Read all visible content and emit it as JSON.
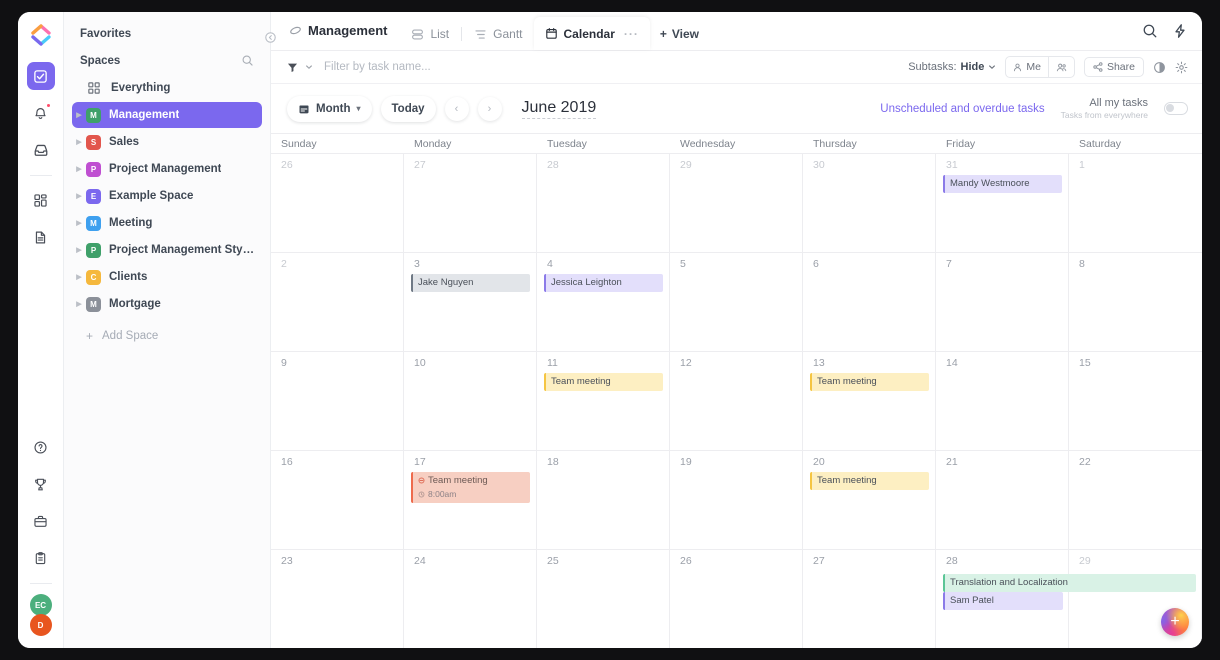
{
  "rail": {
    "logo": "clickup-logo",
    "items": [
      {
        "name": "tasks-checkbox",
        "icon": "check-square-icon",
        "active": true
      },
      {
        "name": "notifications",
        "icon": "bell-icon",
        "active": false,
        "dot": true
      },
      {
        "name": "inbox",
        "icon": "inbox-icon",
        "active": false
      },
      {
        "name": "dashboards",
        "icon": "grid-icon",
        "active": false
      },
      {
        "name": "docs",
        "icon": "document-icon",
        "active": false
      }
    ],
    "bottom_items": [
      {
        "name": "help",
        "icon": "question-circle-icon"
      },
      {
        "name": "goals",
        "icon": "trophy-icon"
      },
      {
        "name": "toolbox",
        "icon": "briefcase-icon"
      },
      {
        "name": "clipboard",
        "icon": "clipboard-icon"
      }
    ],
    "avatars": [
      {
        "initials": "EC",
        "color": "#4caf7d"
      },
      {
        "initials": "D",
        "color": "#e8551f"
      }
    ]
  },
  "sidebar": {
    "favorites_title": "Favorites",
    "spaces_title": "Spaces",
    "search_icon": "search-icon",
    "everything": {
      "label": "Everything",
      "icon": "grid-icon"
    },
    "spaces": [
      {
        "initial": "M",
        "label": "Management",
        "color": "#3fa06a",
        "selected": true
      },
      {
        "initial": "S",
        "label": "Sales",
        "color": "#e2564d",
        "selected": false
      },
      {
        "initial": "P",
        "label": "Project Management",
        "color": "#bf4fd1",
        "selected": false
      },
      {
        "initial": "E",
        "label": "Example Space",
        "color": "#7b68ee",
        "selected": false
      },
      {
        "initial": "M",
        "label": "Meeting",
        "color": "#3ea0ef",
        "selected": false
      },
      {
        "initial": "P",
        "label": "Project Management Styles",
        "color": "#3fa06a",
        "selected": false
      },
      {
        "initial": "C",
        "label": "Clients",
        "color": "#f5b83d",
        "selected": false
      },
      {
        "initial": "M",
        "label": "Mortgage",
        "color": "#8b9099",
        "selected": false
      }
    ],
    "add_space": "Add Space"
  },
  "topbar": {
    "breadcrumb": "Management",
    "breadcrumb_icon": "space-icon",
    "tabs": [
      {
        "label": "List",
        "icon": "list-icon",
        "active": false
      },
      {
        "label": "Gantt",
        "icon": "gantt-icon",
        "active": false
      },
      {
        "label": "Calendar",
        "icon": "calendar-icon",
        "active": true
      }
    ],
    "tab_overflow": "···",
    "add_view": "View",
    "add_view_plus": "+",
    "search_icon": "search-icon",
    "bolt_icon": "lightning-bolt-icon"
  },
  "filterbar": {
    "filter_icon": "filter-icon",
    "filter_caret": "chevron-down-icon",
    "placeholder": "Filter by task name...",
    "subtasks_label": "Subtasks:",
    "subtasks_value": "Hide",
    "me_label": "Me",
    "me_icon": "person-icon",
    "people_icon": "people-icon",
    "share_label": "Share",
    "share_icon": "share-icon",
    "palette_icon": "palette-icon",
    "settings_icon": "gear-icon"
  },
  "calbar": {
    "view_mode": "Month",
    "view_mode_icon": "calendar-icon",
    "view_mode_caret": "▾",
    "today": "Today",
    "prev": "‹",
    "next": "›",
    "month_title": "June 2019",
    "unscheduled_link": "Unscheduled and overdue tasks",
    "all_my_tasks": "All my tasks",
    "all_my_tasks_sub": "Tasks from everywhere",
    "toggle_on": false
  },
  "calendar": {
    "daynames": [
      "Sunday",
      "Monday",
      "Tuesday",
      "Wednesday",
      "Thursday",
      "Friday",
      "Saturday"
    ],
    "weeks": [
      {
        "days": [
          {
            "num": "26",
            "out": true,
            "events": []
          },
          {
            "num": "27",
            "out": true,
            "events": []
          },
          {
            "num": "28",
            "out": true,
            "events": []
          },
          {
            "num": "29",
            "out": true,
            "events": []
          },
          {
            "num": "30",
            "out": true,
            "events": []
          },
          {
            "num": "31",
            "out": true,
            "events": [
              {
                "title": "Mandy Westmoore",
                "style": "ev-purple"
              }
            ]
          },
          {
            "num": "1",
            "out": true,
            "events": []
          }
        ]
      },
      {
        "days": [
          {
            "num": "2",
            "out": true,
            "events": []
          },
          {
            "num": "3",
            "out": false,
            "events": [
              {
                "title": "Jake Nguyen",
                "style": "ev-gray"
              }
            ]
          },
          {
            "num": "4",
            "out": false,
            "events": [
              {
                "title": "Jessica Leighton",
                "style": "ev-purple"
              }
            ]
          },
          {
            "num": "5",
            "out": false,
            "events": []
          },
          {
            "num": "6",
            "out": false,
            "events": []
          },
          {
            "num": "7",
            "out": false,
            "events": []
          },
          {
            "num": "8",
            "out": false,
            "events": []
          }
        ]
      },
      {
        "days": [
          {
            "num": "9",
            "out": false,
            "events": []
          },
          {
            "num": "10",
            "out": false,
            "events": []
          },
          {
            "num": "11",
            "out": false,
            "events": [
              {
                "title": "Team meeting",
                "style": "ev-yellow"
              }
            ]
          },
          {
            "num": "12",
            "out": false,
            "events": []
          },
          {
            "num": "13",
            "out": false,
            "events": [
              {
                "title": "Team meeting",
                "style": "ev-yellow"
              }
            ]
          },
          {
            "num": "14",
            "out": false,
            "events": []
          },
          {
            "num": "15",
            "out": false,
            "events": []
          }
        ]
      },
      {
        "days": [
          {
            "num": "16",
            "out": false,
            "events": []
          },
          {
            "num": "17",
            "out": false,
            "events": [
              {
                "title": "Team meeting",
                "style": "ev-salmon",
                "icon": "priority-circle-icon",
                "time": "8:00am",
                "time_icon": "clock-icon"
              }
            ]
          },
          {
            "num": "18",
            "out": false,
            "events": []
          },
          {
            "num": "19",
            "out": false,
            "events": []
          },
          {
            "num": "20",
            "out": false,
            "events": [
              {
                "title": "Team meeting",
                "style": "ev-yellow"
              }
            ]
          },
          {
            "num": "21",
            "out": false,
            "events": []
          },
          {
            "num": "22",
            "out": false,
            "events": []
          }
        ]
      },
      {
        "days": [
          {
            "num": "23",
            "out": false,
            "events": []
          },
          {
            "num": "24",
            "out": false,
            "events": []
          },
          {
            "num": "25",
            "out": false,
            "events": []
          },
          {
            "num": "26",
            "out": false,
            "events": []
          },
          {
            "num": "27",
            "out": false,
            "events": []
          },
          {
            "num": "28",
            "out": false,
            "events": []
          },
          {
            "num": "29",
            "out": true,
            "events": []
          }
        ],
        "spanning": [
          {
            "title": "Translation and Localization",
            "style": "ev-mint",
            "span_class": "ev-span"
          },
          {
            "title": "Sam Patel",
            "style": "ev-purple",
            "span_class": "ev-span2"
          }
        ]
      }
    ]
  },
  "fab": {
    "label": "+",
    "name": "add-task-button"
  }
}
